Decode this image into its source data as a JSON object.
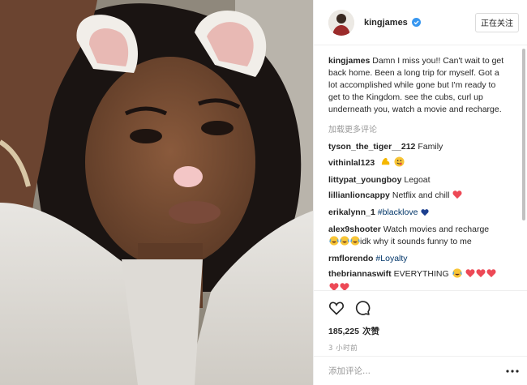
{
  "post": {
    "username": "kingjames",
    "follow_label": "正在关注",
    "caption": {
      "user": "kingjames",
      "text": "Damn I miss you!! Can't wait to get back home. Been a long trip for myself. Got a lot accomplished while gone but I'm ready to get to the Kingdom. see the cubs, curl up underneath you, watch a movie and recharge."
    },
    "load_more": "加载更多评论",
    "comments": [
      {
        "user": "tyson_the_tiger__212",
        "text": "Family"
      },
      {
        "user": "vithinlal123",
        "text": ""
      },
      {
        "user": "littypat_youngboy",
        "text": "Legoat"
      },
      {
        "user": "lillianlioncappy",
        "text": "Netflix and chill"
      },
      {
        "user": "erikalynn_1",
        "text": "#blacklove"
      },
      {
        "user": "alex9shooter",
        "text": "Watch movies and recharge",
        "text2": "idk why it sounds funny to me"
      },
      {
        "user": "rmflorendo",
        "text": "#Loyalty"
      },
      {
        "user": "thebriannaswift",
        "text": "EVERYTHING"
      }
    ],
    "likes_count": "185,225",
    "likes_unit": "次赞",
    "time_ago": "3 小时前",
    "add_comment_placeholder": "添加评论...",
    "icons": {
      "like": "heart-outline-icon",
      "comment": "speech-bubble-icon",
      "options": "more-dots-icon",
      "verified": "verified-badge-icon"
    },
    "colors": {
      "verified": "#3897f0",
      "heart_red": "#ed4956",
      "link": "#003569"
    }
  }
}
